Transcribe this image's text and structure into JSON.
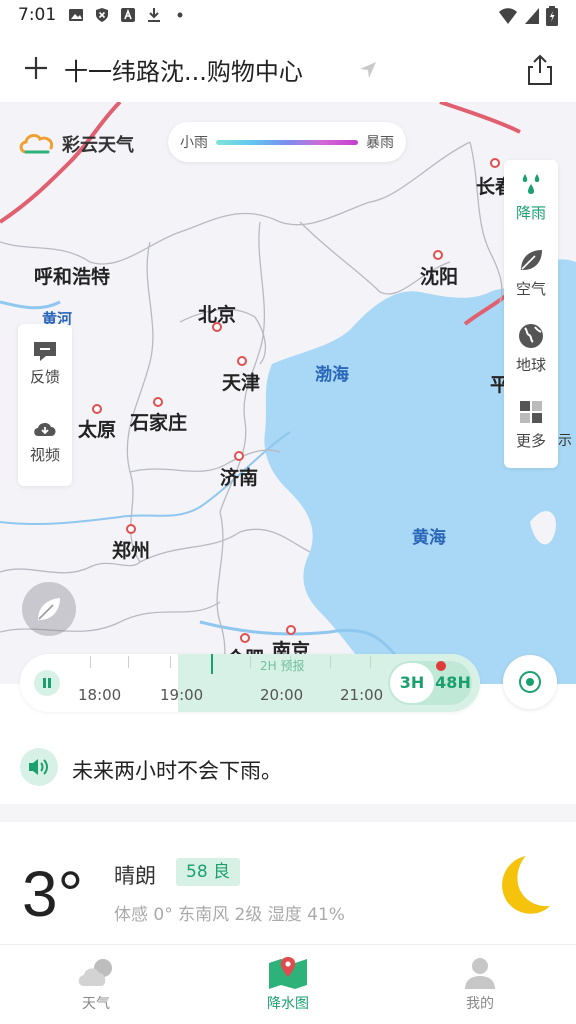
{
  "status_bar": {
    "time": "7:01"
  },
  "header": {
    "location": "十一纬路沈...购物中心"
  },
  "brand": {
    "name": "彩云天气"
  },
  "legend": {
    "low_label": "小雨",
    "high_label": "暴雨"
  },
  "map": {
    "cities": [
      "长春",
      "呼和浩特",
      "沈阳",
      "北京",
      "天津",
      "太原",
      "石家庄",
      "济南",
      "郑州",
      "合肥",
      "南京",
      "平"
    ],
    "seas": [
      "渤海",
      "黄海"
    ],
    "river": "黄河",
    "edge_text": "示"
  },
  "right_panel": [
    {
      "label": "降雨",
      "icon": "rain-drops-icon",
      "active": true
    },
    {
      "label": "空气",
      "icon": "leaf-icon",
      "active": false
    },
    {
      "label": "地球",
      "icon": "globe-icon",
      "active": false
    },
    {
      "label": "更多",
      "icon": "grid-icon",
      "active": false
    }
  ],
  "left_panel": [
    {
      "label": "反馈",
      "icon": "feedback-icon"
    },
    {
      "label": "视频",
      "icon": "download-cloud-icon"
    }
  ],
  "timeline": {
    "times": [
      "18:00",
      "19:00",
      "20:00",
      "21:00"
    ],
    "forecast_label": "2H 预报",
    "range_3h": "3H",
    "range_48h": "48H"
  },
  "summary": {
    "text": "未来两小时不会下雨。"
  },
  "weather": {
    "temperature": "3°",
    "condition": "晴朗",
    "aqi": "58 良",
    "details": "体感 0°   东南风 2级   湿度 41%"
  },
  "nav": [
    {
      "label": "天气",
      "icon": "cloud-icon",
      "active": false
    },
    {
      "label": "降水图",
      "icon": "map-pin-icon",
      "active": true
    },
    {
      "label": "我的",
      "icon": "user-icon",
      "active": false
    }
  ],
  "colors": {
    "accent": "#1a9f6f",
    "sea": "#a8d8f5",
    "province_border": "#e06070"
  }
}
